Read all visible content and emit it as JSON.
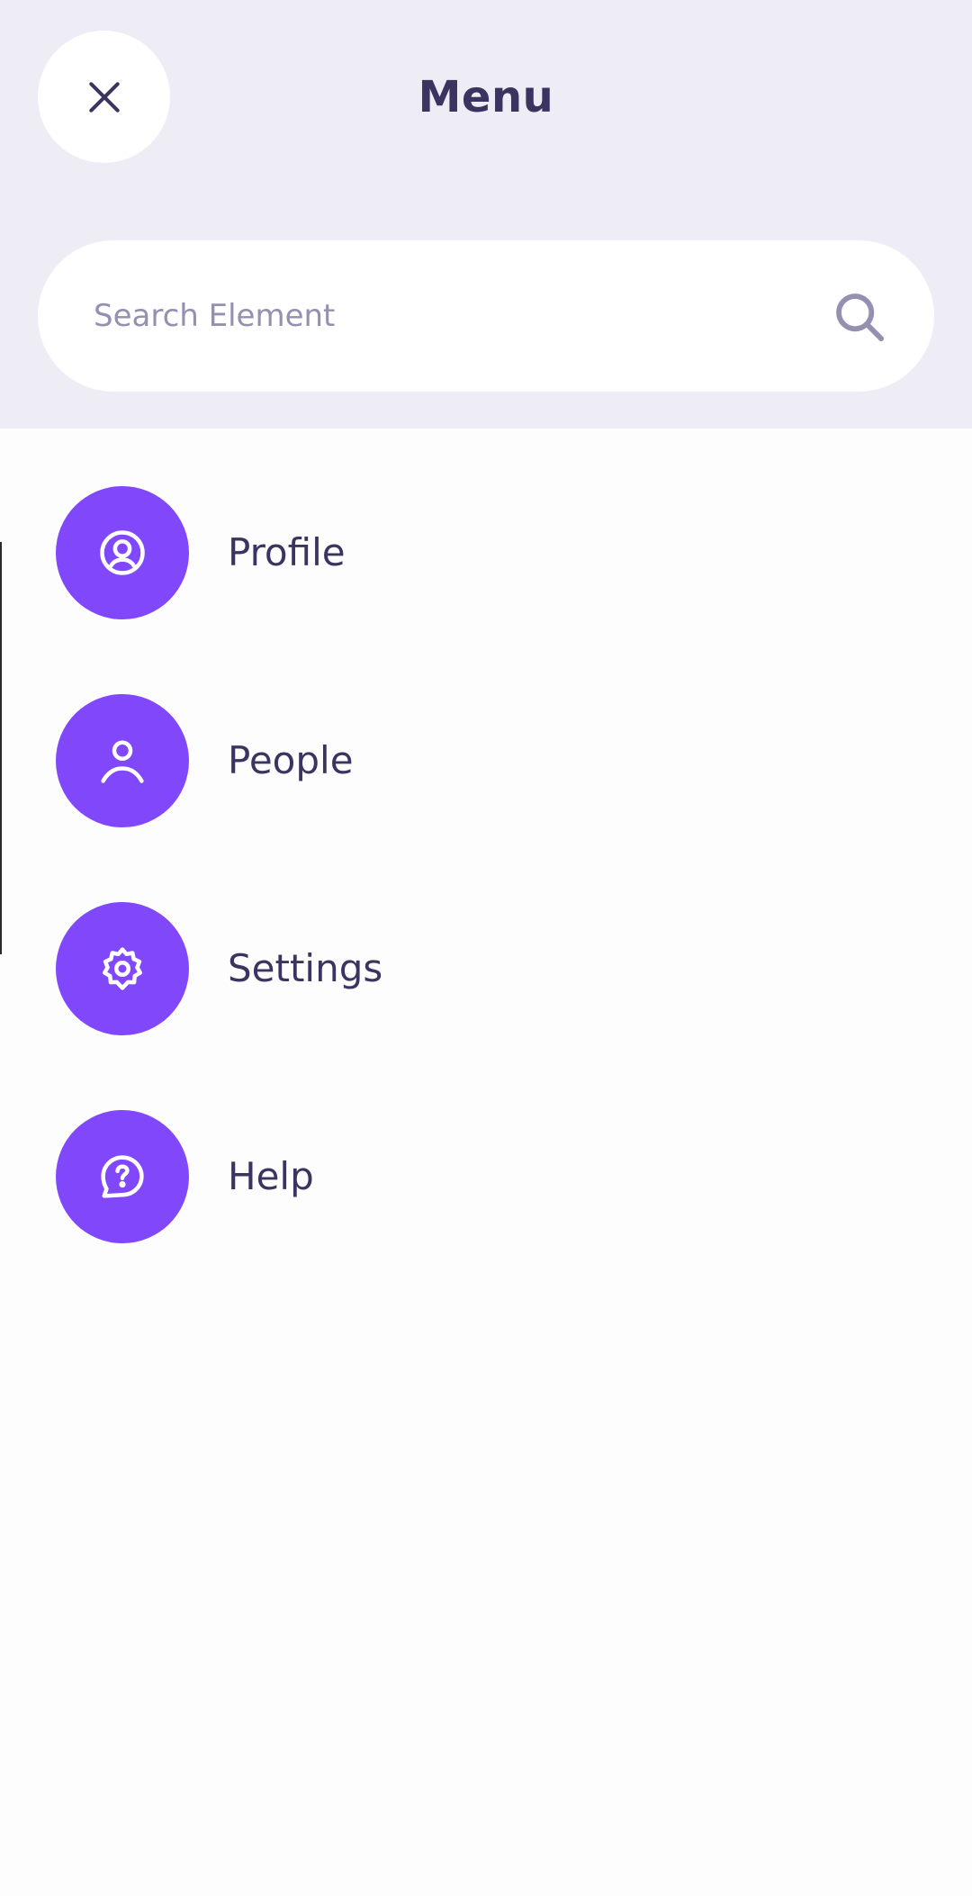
{
  "header": {
    "title": "Menu",
    "close_icon": "close-icon",
    "background_color": "#eeecf5"
  },
  "search": {
    "placeholder": "Search Element",
    "value": "",
    "icon": "search-icon"
  },
  "menu": {
    "accent_color": "#8047fb",
    "items": [
      {
        "label": "Profile",
        "icon": "profile-circle-icon"
      },
      {
        "label": "People",
        "icon": "person-icon"
      },
      {
        "label": "Settings",
        "icon": "gear-icon"
      },
      {
        "label": "Help",
        "icon": "help-chat-icon"
      }
    ]
  }
}
